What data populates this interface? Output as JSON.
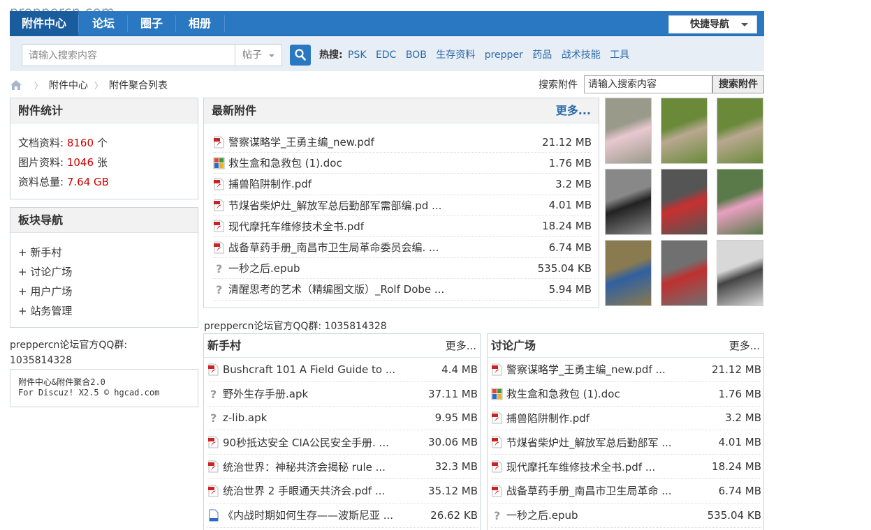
{
  "watermark": "preppercn.com",
  "nav": {
    "items": [
      "附件中心",
      "论坛",
      "圈子",
      "相册"
    ],
    "quick_nav": "快捷导航"
  },
  "search": {
    "placeholder": "请输入搜索内容",
    "type": "帖子",
    "hot_label": "热搜:",
    "hot_links": [
      "PSK",
      "EDC",
      "BOB",
      "生存资料",
      "prepper",
      "药品",
      "战术技能",
      "工具"
    ]
  },
  "breadcrumb": [
    "附件中心",
    "附件聚合列表"
  ],
  "attachment_search": {
    "label": "搜索附件",
    "input_value": "请输入搜索内容",
    "button": "搜索附件"
  },
  "stats": {
    "title": "附件统计",
    "rows": [
      {
        "label": "文档资料:",
        "value": "8160",
        "unit": "个"
      },
      {
        "label": "图片资料:",
        "value": "1046",
        "unit": "张"
      },
      {
        "label": "资料总量:",
        "value": "7.64 GB",
        "unit": ""
      }
    ]
  },
  "board_nav": {
    "title": "板块导航",
    "items": [
      "新手村",
      "讨论广场",
      "用户广场",
      "站务管理"
    ]
  },
  "qq_left": {
    "line1": "preppercn论坛官方QQ群:",
    "line2": "1035814328"
  },
  "credit": {
    "line1": "附件中心&附件聚合2.0",
    "line2": "For Discuz! X2.5 © hgcad.com"
  },
  "latest": {
    "title": "最新附件",
    "more": "更多...",
    "files": [
      {
        "icon": "pdf",
        "name": "警察谋略学_王勇主编_new.pdf",
        "size": "21.12 MB"
      },
      {
        "icon": "doc",
        "name": "救生盒和急救包 (1).doc",
        "size": "1.76 MB"
      },
      {
        "icon": "pdf",
        "name": "捕兽陷阱制作.pdf",
        "size": "3.2 MB"
      },
      {
        "icon": "pdf",
        "name": "节煤省柴炉灶_解放军总后勤部军需部编.pd ...",
        "size": "4.01 MB"
      },
      {
        "icon": "pdf",
        "name": "现代摩托车维修技术全书.pdf",
        "size": "18.24 MB"
      },
      {
        "icon": "pdf",
        "name": "战备草药手册_南昌市卫生局革命委员会编. ...",
        "size": "6.74 MB"
      },
      {
        "icon": "unknown",
        "name": "一秒之后.epub",
        "size": "535.04 KB"
      },
      {
        "icon": "unknown",
        "name": "清醒思考的艺术（精编图文版）_Rolf Dobe ...",
        "size": "5.94 MB"
      }
    ]
  },
  "qq_mid": "preppercn论坛官方QQ群:  1035814328",
  "newbie": {
    "title": "新手村",
    "more": "更多...",
    "files": [
      {
        "icon": "pdf",
        "name": "Bushcraft 101 A Field Guide to ...",
        "size": "4.4 MB"
      },
      {
        "icon": "unknown",
        "name": "野外生存手册.apk",
        "size": "37.11 MB"
      },
      {
        "icon": "unknown",
        "name": "z-lib.apk",
        "size": "9.95 MB"
      },
      {
        "icon": "pdf",
        "name": "90秒抵达安全 CIA公民安全手册. ...",
        "size": "30.06 MB"
      },
      {
        "icon": "pdf",
        "name": "统治世界：神秘共济会揭秘 rule ...",
        "size": "32.3 MB"
      },
      {
        "icon": "pdf",
        "name": "统治世界 2 手眼通天共济会.pdf ...",
        "size": "35.12 MB"
      },
      {
        "icon": "file",
        "name": "《内战时期如何生存——波斯尼亚 ...",
        "size": "26.62 KB"
      }
    ]
  },
  "discuss": {
    "title": "讨论广场",
    "more": "更多...",
    "files": [
      {
        "icon": "pdf",
        "name": "警察谋略学_王勇主编_new.pdf ...",
        "size": "21.12 MB"
      },
      {
        "icon": "doc",
        "name": "救生盒和急救包 (1).doc",
        "size": "1.76 MB"
      },
      {
        "icon": "pdf",
        "name": "捕兽陷阱制作.pdf",
        "size": "3.2 MB"
      },
      {
        "icon": "pdf",
        "name": "节煤省柴炉灶_解放军总后勤部军 ...",
        "size": "4.01 MB"
      },
      {
        "icon": "pdf",
        "name": "现代摩托车维修技术全书.pdf ...",
        "size": "18.24 MB"
      },
      {
        "icon": "pdf",
        "name": "战备草药手册_南昌市卫生局革命 ...",
        "size": "6.74 MB"
      },
      {
        "icon": "unknown",
        "name": "一秒之后.epub",
        "size": "535.04 KB"
      }
    ]
  },
  "thumbnails": [
    {
      "name": "pink-canister-photo",
      "colors": [
        "#9a9a8a",
        "#e8c8d0"
      ]
    },
    {
      "name": "gear-on-grass-photo",
      "colors": [
        "#6a8a3a",
        "#b8a890"
      ]
    },
    {
      "name": "gear-on-grass-photo-2",
      "colors": [
        "#6a8a3a",
        "#b8a890"
      ]
    },
    {
      "name": "gas-mask-photo",
      "colors": [
        "#888888",
        "#222222"
      ]
    },
    {
      "name": "red-canister-hose-photo",
      "colors": [
        "#555555",
        "#c83030"
      ]
    },
    {
      "name": "pink-can-grass-photo",
      "colors": [
        "#5a7a4a",
        "#e8a0c0"
      ]
    },
    {
      "name": "kit-bag-photo",
      "colors": [
        "#8a7a50",
        "#3060a0"
      ]
    },
    {
      "name": "medical-supplies-photo",
      "colors": [
        "#707070",
        "#c03030"
      ]
    },
    {
      "name": "respirator-box-photo",
      "colors": [
        "#d8d8d8",
        "#444444"
      ]
    }
  ]
}
